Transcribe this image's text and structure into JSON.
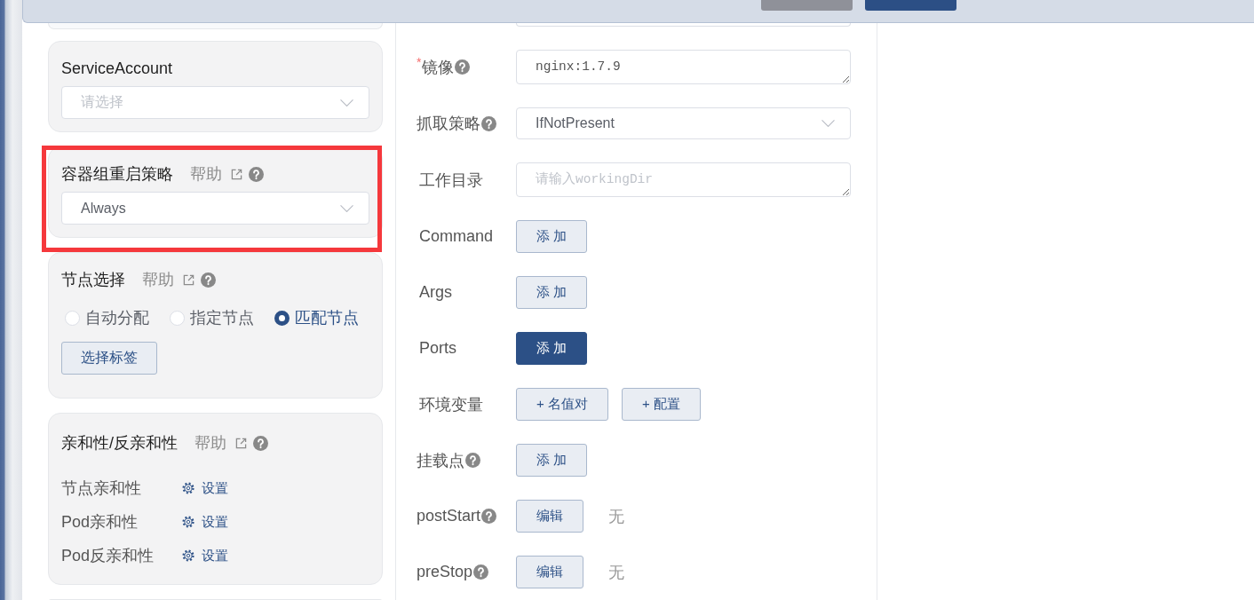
{
  "header": {
    "buttons": [
      {
        "kind": "secondary"
      },
      {
        "kind": "primary"
      }
    ]
  },
  "left_cards": [
    {
      "kind": "clipped",
      "highlighted": false
    },
    {
      "kind": "select",
      "title": "ServiceAccount",
      "highlighted": false,
      "select": {
        "placeholder": "请选择"
      }
    },
    {
      "kind": "select",
      "title": "容器组重启策略",
      "help_link": "帮助",
      "highlighted": true,
      "select": {
        "value": "Always"
      }
    },
    {
      "kind": "radios",
      "title": "节点选择",
      "help_link": "帮助",
      "highlighted": false,
      "options": [
        {
          "label": "自动分配",
          "selected": false
        },
        {
          "label": "指定节点",
          "selected": false
        },
        {
          "label": "匹配节点",
          "selected": true
        }
      ],
      "button": "选择标签"
    },
    {
      "kind": "settings",
      "title": "亲和性/反亲和性",
      "help_link": "帮助",
      "highlighted": false,
      "rows": [
        {
          "label": "节点亲和性",
          "action": "设置"
        },
        {
          "label": "Pod亲和性",
          "action": "设置"
        },
        {
          "label": "Pod反亲和性",
          "action": "设置"
        }
      ]
    },
    {
      "kind": "clipped",
      "highlighted": false
    }
  ],
  "form_rows": [
    {
      "control": {
        "kind": "clipped"
      }
    },
    {
      "label": "镜像",
      "required_mark": "*",
      "help": true,
      "control": {
        "kind": "textarea",
        "value": "nginx:1.7.9"
      }
    },
    {
      "label": "抓取策略",
      "help": true,
      "control": {
        "kind": "select",
        "value": "IfNotPresent"
      }
    },
    {
      "label": "工作目录",
      "help": false,
      "control": {
        "kind": "textarea",
        "placeholder": "请输入workingDir"
      }
    },
    {
      "label": "Command",
      "help": false,
      "control": {
        "kind": "buttons",
        "buttons": [
          {
            "text": "添 加",
            "kind": "default"
          }
        ]
      }
    },
    {
      "label": "Args",
      "help": false,
      "control": {
        "kind": "buttons",
        "buttons": [
          {
            "text": "添 加",
            "kind": "default"
          }
        ]
      }
    },
    {
      "label": "Ports",
      "help": false,
      "control": {
        "kind": "buttons",
        "buttons": [
          {
            "text": "添 加",
            "kind": "primary"
          }
        ]
      }
    },
    {
      "label": "环境变量",
      "help": false,
      "control": {
        "kind": "buttons",
        "buttons": [
          {
            "text": "+ 名值对",
            "kind": "default"
          },
          {
            "text": "+ 配置",
            "kind": "default"
          }
        ]
      }
    },
    {
      "label": "挂载点",
      "help": true,
      "control": {
        "kind": "buttons",
        "buttons": [
          {
            "text": "添 加",
            "kind": "default"
          }
        ]
      }
    },
    {
      "label": "postStart",
      "help": true,
      "control": {
        "kind": "buttons",
        "buttons": [
          {
            "text": "编辑",
            "kind": "default"
          }
        ],
        "note": "无"
      }
    },
    {
      "label": "preStop",
      "help": true,
      "control": {
        "kind": "buttons",
        "buttons": [
          {
            "text": "编辑",
            "kind": "default"
          }
        ],
        "note": "无"
      }
    }
  ]
}
